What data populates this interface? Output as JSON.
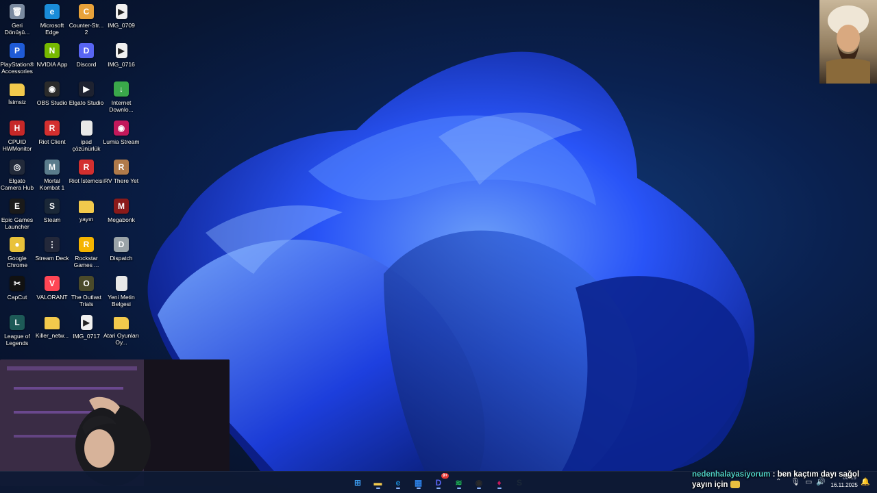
{
  "desktop": {
    "icons": [
      {
        "label": "Geri Dönüşü...",
        "icon": "recycle-bin-icon",
        "color": "#7a8aa0",
        "glyph": "🗑"
      },
      {
        "label": "PlayStation® Accessories",
        "icon": "playstation-icon",
        "color": "#1f5bd6",
        "glyph": "P"
      },
      {
        "label": "İsimsiz",
        "icon": "folder-icon",
        "color": "#f2c94c",
        "glyph": ""
      },
      {
        "label": "CPUID HWMonitor",
        "icon": "hwmonitor-icon",
        "color": "#c62828",
        "glyph": "H"
      },
      {
        "label": "Elgato Camera Hub",
        "icon": "camera-hub-icon",
        "color": "#222a3a",
        "glyph": "◎"
      },
      {
        "label": "Epic Games Launcher",
        "icon": "epic-games-icon",
        "color": "#1a1a1a",
        "glyph": "E"
      },
      {
        "label": "Google Chrome",
        "icon": "chrome-icon",
        "color": "#e9c23a",
        "glyph": "●"
      },
      {
        "label": "CapCut",
        "icon": "capcut-icon",
        "color": "#111111",
        "glyph": "✂"
      },
      {
        "label": "League of Legends",
        "icon": "league-icon",
        "color": "#1d5a57",
        "glyph": "L"
      },
      {
        "label": "Microsoft Edge",
        "icon": "edge-icon",
        "color": "#1a8cd8",
        "glyph": "e"
      },
      {
        "label": "NVIDIA App",
        "icon": "nvidia-icon",
        "color": "#76b900",
        "glyph": "N"
      },
      {
        "label": "OBS Studio",
        "icon": "obs-icon",
        "color": "#2b2b2b",
        "glyph": "◉"
      },
      {
        "label": "Riot Client",
        "icon": "riot-client-icon",
        "color": "#d32f2f",
        "glyph": "R"
      },
      {
        "label": "Mortal Kombat 1",
        "icon": "mortal-kombat-icon",
        "color": "#5a7c8c",
        "glyph": "M"
      },
      {
        "label": "Steam",
        "icon": "steam-icon",
        "color": "#1b2838",
        "glyph": "S"
      },
      {
        "label": "Stream Deck",
        "icon": "stream-deck-icon",
        "color": "#23283a",
        "glyph": "⋮"
      },
      {
        "label": "VALORANT",
        "icon": "valorant-icon",
        "color": "#ff4655",
        "glyph": "V"
      },
      {
        "label": "Killer_netw...",
        "icon": "folder-icon",
        "color": "#f2c94c",
        "glyph": ""
      },
      {
        "label": "Counter-Str... 2",
        "icon": "cs2-icon",
        "color": "#e8a23a",
        "glyph": "C"
      },
      {
        "label": "Discord",
        "icon": "discord-icon",
        "color": "#5865f2",
        "glyph": "D"
      },
      {
        "label": "Elgato Studio",
        "icon": "elgato-studio-icon",
        "color": "#1e2230",
        "glyph": "▶"
      },
      {
        "label": "ipad çözünürlük",
        "icon": "text-file-icon",
        "color": "#e8e8e8",
        "glyph": ""
      },
      {
        "label": "Riot İstemcisi",
        "icon": "riot-client-icon",
        "color": "#d32f2f",
        "glyph": "R"
      },
      {
        "label": "yayın",
        "icon": "folder-icon",
        "color": "#f2c94c",
        "glyph": ""
      },
      {
        "label": "Rockstar Games ...",
        "icon": "rockstar-icon",
        "color": "#f5b400",
        "glyph": "R"
      },
      {
        "label": "The Outlast Trials",
        "icon": "outlast-icon",
        "color": "#4a4a2a",
        "glyph": "O"
      },
      {
        "label": "IMG_0717",
        "icon": "video-file-icon",
        "color": "#f0f0f0",
        "glyph": "▶"
      },
      {
        "label": "IMG_0709",
        "icon": "video-file-icon",
        "color": "#f0f0f0",
        "glyph": "▶"
      },
      {
        "label": "IMG_0716",
        "icon": "video-file-icon",
        "color": "#f0f0f0",
        "glyph": "▶"
      },
      {
        "label": "Internet Downlo...",
        "icon": "idm-icon",
        "color": "#3aa84a",
        "glyph": "↓"
      },
      {
        "label": "Lumia Stream",
        "icon": "lumia-stream-icon",
        "color": "#c2185b",
        "glyph": "◉"
      },
      {
        "label": "RV There Yet",
        "icon": "rv-there-yet-icon",
        "color": "#b07a4a",
        "glyph": "R"
      },
      {
        "label": "Megabonk",
        "icon": "megabonk-icon",
        "color": "#8a1a1a",
        "glyph": "M"
      },
      {
        "label": "Dispatch",
        "icon": "dispatch-icon",
        "color": "#9aa3a8",
        "glyph": "D"
      },
      {
        "label": "Yeni Metin Belgesi",
        "icon": "text-file-icon",
        "color": "#e8e8e8",
        "glyph": ""
      },
      {
        "label": "Atari Oyunları Oy...",
        "icon": "folder-icon",
        "color": "#f2c94c",
        "glyph": ""
      }
    ]
  },
  "taskbar": {
    "apps": [
      {
        "name": "start-button",
        "icon": "windows-logo-icon",
        "color": "#3c9cf0",
        "glyph": "⊞"
      },
      {
        "name": "taskbar-file-explorer",
        "icon": "folder-icon",
        "color": "#f2c94c",
        "glyph": "▬"
      },
      {
        "name": "taskbar-edge",
        "icon": "edge-icon",
        "color": "#1a8cd8",
        "glyph": "e"
      },
      {
        "name": "taskbar-store",
        "icon": "store-icon",
        "color": "#2a7de1",
        "glyph": "▦"
      },
      {
        "name": "taskbar-discord",
        "icon": "discord-icon",
        "color": "#5865f2",
        "glyph": "D"
      },
      {
        "name": "taskbar-spotify",
        "icon": "spotify-icon",
        "color": "#1db954",
        "glyph": "≋"
      },
      {
        "name": "taskbar-obs",
        "icon": "obs-icon",
        "color": "#2b2b2b",
        "glyph": "◉"
      },
      {
        "name": "taskbar-lumia",
        "icon": "lumia-stream-icon",
        "color": "#c2185b",
        "glyph": "♦"
      },
      {
        "name": "taskbar-steam",
        "icon": "steam-icon",
        "color": "#1b2838",
        "glyph": "S"
      }
    ],
    "discord_badge": "9+",
    "tray": {
      "time": "00:19",
      "date": "16.11.2025",
      "icons": [
        "chevron-up-icon",
        "microphone-icon",
        "network-icon",
        "volume-icon",
        "notification-icon"
      ]
    }
  },
  "chat": {
    "username": "nedenhalayasiyorum",
    "message": ": ben kaçtım dayı sağol yayın için",
    "emote": "emote-icon"
  },
  "colors": {
    "wallpaper_dark": "#081633",
    "bloom_blue": "#1f4fff",
    "chat_user": "#4fd0c7"
  }
}
